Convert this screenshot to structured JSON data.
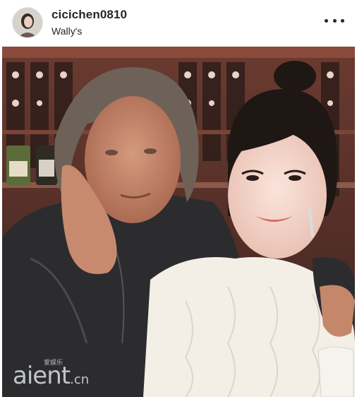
{
  "post": {
    "username": "cicichen0810",
    "location": "Wally's",
    "more_icon": "more-horizontal-icon",
    "avatar_icon": "profile-avatar"
  },
  "photo": {
    "watermark_main": "aient",
    "watermark_suffix": ".cn",
    "watermark_small": "爱娱乐"
  },
  "colors": {
    "text": "#262626",
    "background": "#ffffff"
  }
}
